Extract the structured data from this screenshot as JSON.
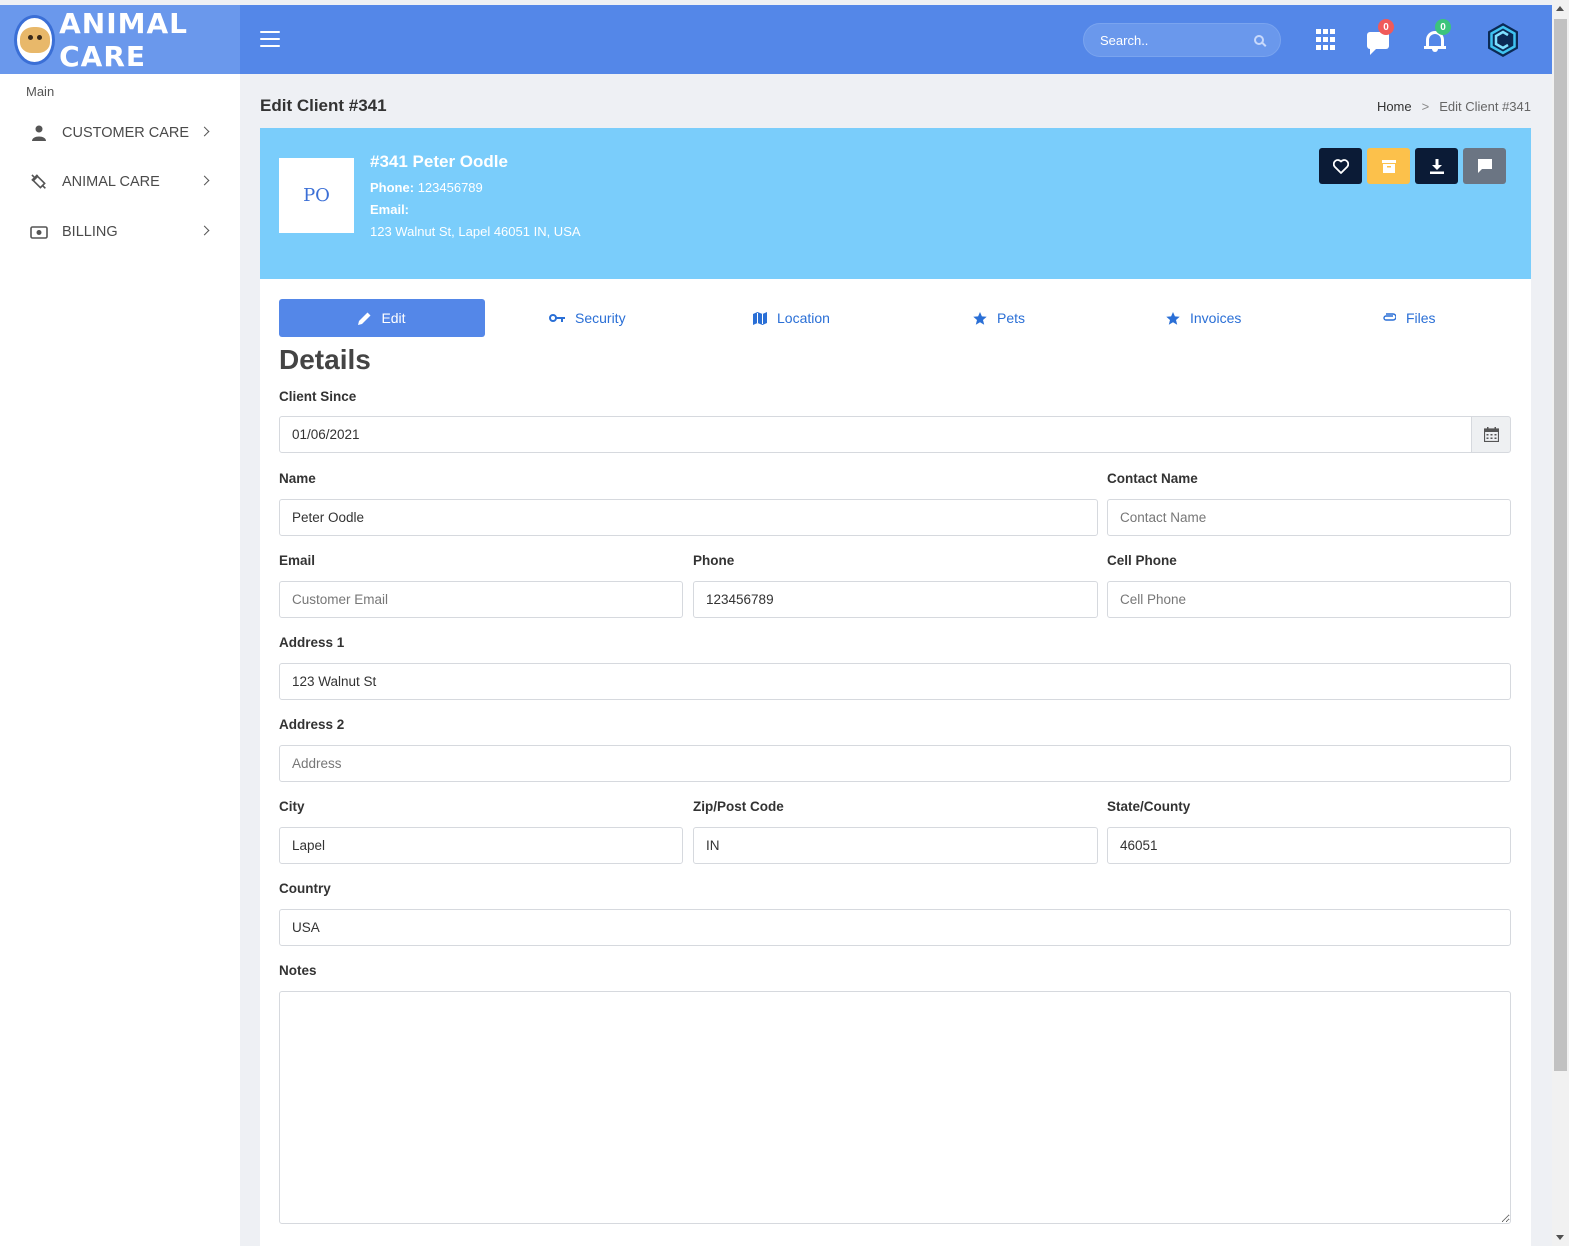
{
  "brand": {
    "name": "ANIMAL CARE"
  },
  "topbar": {
    "search_placeholder": "Search..",
    "messages_count": "0",
    "notifications_count": "0",
    "colors": {
      "bar": "#5487e8",
      "brand_bg": "#6a98ec"
    }
  },
  "sidebar": {
    "section": "Main",
    "items": [
      {
        "label": "CUSTOMER CARE",
        "icon": "user-icon"
      },
      {
        "label": "ANIMAL CARE",
        "icon": "syringe-icon"
      },
      {
        "label": "BILLING",
        "icon": "money-icon"
      }
    ]
  },
  "page": {
    "title": "Edit Client #341",
    "breadcrumb": {
      "home": "Home",
      "sep": ">",
      "current": "Edit Client #341"
    }
  },
  "hero": {
    "initials": "PO",
    "name": "#341 Peter Oodle",
    "phone_label": "Phone:",
    "phone": "123456789",
    "email_label": "Email:",
    "email": "",
    "address": "123 Walnut St, Lapel 46051 IN, USA",
    "actions": [
      "heart-icon",
      "archive-icon",
      "download-icon",
      "comment-icon"
    ],
    "colors": {
      "background": "#7acdfb",
      "dark_btn": "#0b1b36",
      "yellow_btn": "#fcc14b",
      "gray_btn": "#6b7583"
    }
  },
  "tabs": [
    {
      "label": "Edit",
      "icon": "pencil-icon",
      "active": true
    },
    {
      "label": "Security",
      "icon": "key-icon"
    },
    {
      "label": "Location",
      "icon": "map-icon"
    },
    {
      "label": "Pets",
      "icon": "star-icon"
    },
    {
      "label": "Invoices",
      "icon": "star-icon"
    },
    {
      "label": "Files",
      "icon": "paperclip-icon"
    }
  ],
  "form": {
    "heading": "Details",
    "client_since": {
      "label": "Client Since",
      "value": "01/06/2021"
    },
    "name": {
      "label": "Name",
      "value": "Peter Oodle"
    },
    "contact_name": {
      "label": "Contact Name",
      "placeholder": "Contact Name"
    },
    "email": {
      "label": "Email",
      "placeholder": "Customer Email"
    },
    "phone": {
      "label": "Phone",
      "value": "123456789"
    },
    "cell_phone": {
      "label": "Cell Phone",
      "placeholder": "Cell Phone"
    },
    "address1": {
      "label": "Address 1",
      "value": "123 Walnut St"
    },
    "address2": {
      "label": "Address 2",
      "placeholder": "Address"
    },
    "city": {
      "label": "City",
      "value": "Lapel"
    },
    "zip": {
      "label": "Zip/Post Code",
      "value": "IN"
    },
    "state": {
      "label": "State/County",
      "value": "46051"
    },
    "country": {
      "label": "Country",
      "value": "USA"
    },
    "notes": {
      "label": "Notes",
      "value": ""
    }
  }
}
